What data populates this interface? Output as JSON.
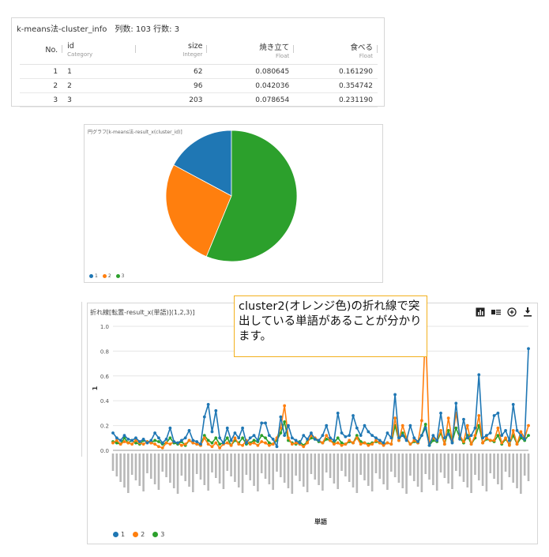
{
  "table": {
    "title": "k-means法-cluster_info　列数: 103 行数: 3",
    "columns": [
      {
        "name": "No.",
        "type": ""
      },
      {
        "name": "id",
        "type": "Category"
      },
      {
        "name": "size",
        "type": "Integer"
      },
      {
        "name": "焼き立て",
        "type": "Float"
      },
      {
        "name": "食べる",
        "type": "Float"
      }
    ],
    "rows": [
      [
        "1",
        "1",
        "62",
        "0.080645",
        "0.161290"
      ],
      [
        "2",
        "2",
        "96",
        "0.042036",
        "0.354742"
      ],
      [
        "3",
        "3",
        "203",
        "0.078654",
        "0.231190"
      ]
    ]
  },
  "pie": {
    "title": "円グラフ[k-means法-result_x(cluster_id)]",
    "legend": [
      "1",
      "2",
      "3"
    ]
  },
  "line_panel": {
    "title": "折れ線[転置-result_x(単語)](1,2,3)]",
    "ylabel": "1",
    "xlabel": "単語",
    "legend": [
      "1",
      "2",
      "3"
    ],
    "tools": [
      "bar-chart-icon",
      "data-view-icon",
      "zoom-icon",
      "download-icon"
    ]
  },
  "annotation": {
    "text": "cluster2(オレンジ色)の折れ線で突出している単語があることが分かります。"
  },
  "colors": {
    "series1": "#1f77b4",
    "series2": "#ff7f0e",
    "series3": "#2ca02c",
    "annotation_border": "#f2b01e"
  },
  "chart_data": [
    {
      "type": "pie",
      "title": "円グラフ[k-means法-result_x(cluster_id)]",
      "categories": [
        "1",
        "2",
        "3"
      ],
      "values": [
        62,
        96,
        203
      ]
    },
    {
      "type": "line",
      "title": "折れ線[転置-result_x(単語)](1,2,3)]",
      "xlabel": "単語",
      "ylabel": "1",
      "ylim": [
        0,
        1.0
      ],
      "yticks": [
        "0.0",
        "0.2",
        "0.4",
        "0.6",
        "0.8",
        "1.0"
      ],
      "grid": true,
      "legend_position": "bottom-left",
      "series": [
        {
          "name": "1",
          "values": [
            0.14,
            0.1,
            0.08,
            0.12,
            0.09,
            0.08,
            0.1,
            0.07,
            0.09,
            0.06,
            0.08,
            0.14,
            0.1,
            0.06,
            0.09,
            0.18,
            0.07,
            0.06,
            0.08,
            0.1,
            0.16,
            0.08,
            0.07,
            0.05,
            0.27,
            0.37,
            0.15,
            0.32,
            0.1,
            0.06,
            0.18,
            0.08,
            0.14,
            0.1,
            0.18,
            0.06,
            0.1,
            0.12,
            0.08,
            0.22,
            0.22,
            0.12,
            0.09,
            0.03,
            0.27,
            0.12,
            0.2,
            0.1,
            0.08,
            0.06,
            0.12,
            0.09,
            0.14,
            0.09,
            0.08,
            0.12,
            0.2,
            0.1,
            0.08,
            0.3,
            0.14,
            0.11,
            0.12,
            0.28,
            0.18,
            0.12,
            0.2,
            0.15,
            0.12,
            0.1,
            0.08,
            0.06,
            0.14,
            0.1,
            0.45,
            0.1,
            0.12,
            0.08,
            0.2,
            0.1,
            0.07,
            0.12,
            0.18,
            0.04,
            0.12,
            0.08,
            0.3,
            0.1,
            0.13,
            0.06,
            0.38,
            0.09,
            0.25,
            0.1,
            0.12,
            0.18,
            0.61,
            0.1,
            0.12,
            0.14,
            0.28,
            0.3,
            0.12,
            0.16,
            0.08,
            0.37,
            0.16,
            0.12,
            0.09,
            0.82
          ]
        },
        {
          "name": "2",
          "values": [
            0.06,
            0.08,
            0.05,
            0.07,
            0.06,
            0.05,
            0.08,
            0.06,
            0.05,
            0.07,
            0.06,
            0.05,
            0.03,
            0.02,
            0.06,
            0.05,
            0.07,
            0.06,
            0.04,
            0.05,
            0.08,
            0.06,
            0.05,
            0.04,
            0.1,
            0.05,
            0.03,
            0.06,
            0.02,
            0.05,
            0.06,
            0.04,
            0.1,
            0.05,
            0.04,
            0.08,
            0.05,
            0.06,
            0.04,
            0.07,
            0.06,
            0.04,
            0.05,
            0.1,
            0.18,
            0.36,
            0.1,
            0.05,
            0.06,
            0.05,
            0.03,
            0.06,
            0.12,
            0.1,
            0.08,
            0.06,
            0.12,
            0.08,
            0.05,
            0.06,
            0.04,
            0.05,
            0.08,
            0.06,
            0.1,
            0.05,
            0.06,
            0.04,
            0.05,
            0.08,
            0.06,
            0.04,
            0.06,
            0.05,
            0.26,
            0.08,
            0.2,
            0.1,
            0.05,
            0.08,
            0.06,
            0.24,
            0.99,
            0.06,
            0.1,
            0.08,
            0.16,
            0.05,
            0.26,
            0.08,
            0.3,
            0.12,
            0.07,
            0.2,
            0.05,
            0.12,
            0.28,
            0.06,
            0.1,
            0.08,
            0.08,
            0.18,
            0.06,
            0.1,
            0.04,
            0.16,
            0.05,
            0.15,
            0.1,
            0.2
          ]
        },
        {
          "name": "3",
          "values": [
            0.07,
            0.06,
            0.05,
            0.1,
            0.06,
            0.08,
            0.06,
            0.05,
            0.08,
            0.07,
            0.06,
            0.08,
            0.07,
            0.05,
            0.06,
            0.1,
            0.06,
            0.05,
            0.07,
            0.04,
            0.08,
            0.06,
            0.05,
            0.04,
            0.12,
            0.08,
            0.06,
            0.1,
            0.05,
            0.06,
            0.1,
            0.04,
            0.08,
            0.06,
            0.1,
            0.05,
            0.06,
            0.08,
            0.07,
            0.12,
            0.1,
            0.06,
            0.05,
            0.08,
            0.14,
            0.23,
            0.08,
            0.06,
            0.05,
            0.07,
            0.04,
            0.07,
            0.1,
            0.09,
            0.07,
            0.06,
            0.09,
            0.08,
            0.06,
            0.1,
            0.06,
            0.05,
            0.07,
            0.06,
            0.12,
            0.07,
            0.06,
            0.05,
            0.06,
            0.07,
            0.06,
            0.05,
            0.06,
            0.05,
            0.2,
            0.08,
            0.14,
            0.09,
            0.05,
            0.07,
            0.06,
            0.12,
            0.21,
            0.04,
            0.08,
            0.07,
            0.14,
            0.05,
            0.16,
            0.07,
            0.18,
            0.1,
            0.06,
            0.12,
            0.05,
            0.1,
            0.2,
            0.06,
            0.09,
            0.08,
            0.07,
            0.12,
            0.05,
            0.09,
            0.05,
            0.12,
            0.05,
            0.1,
            0.08,
            0.12
          ]
        }
      ]
    }
  ]
}
